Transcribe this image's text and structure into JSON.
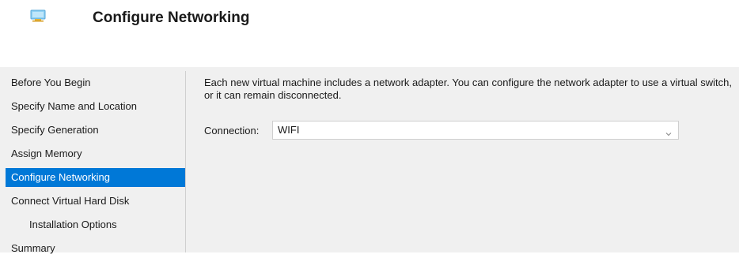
{
  "header": {
    "icon": "network-adapter-icon",
    "title": "Configure Networking"
  },
  "sidebar": {
    "items": [
      {
        "label": "Before You Begin",
        "selected": false,
        "indent": false
      },
      {
        "label": "Specify Name and Location",
        "selected": false,
        "indent": false
      },
      {
        "label": "Specify Generation",
        "selected": false,
        "indent": false
      },
      {
        "label": "Assign Memory",
        "selected": false,
        "indent": false
      },
      {
        "label": "Configure Networking",
        "selected": true,
        "indent": false
      },
      {
        "label": "Connect Virtual Hard Disk",
        "selected": false,
        "indent": false
      },
      {
        "label": "Installation Options",
        "selected": false,
        "indent": true
      },
      {
        "label": "Summary",
        "selected": false,
        "indent": false
      }
    ]
  },
  "main": {
    "description": "Each new virtual machine includes a network adapter. You can configure the network adapter to use a virtual switch, or it can remain disconnected.",
    "connection_label": "Connection:",
    "connection_value": "WIFI",
    "dropdown_icon": "chevron-down-icon"
  },
  "colors": {
    "selected_bg": "#0078d7",
    "selected_text": "#ffffff",
    "panel_bg": "#f0f0f0"
  }
}
